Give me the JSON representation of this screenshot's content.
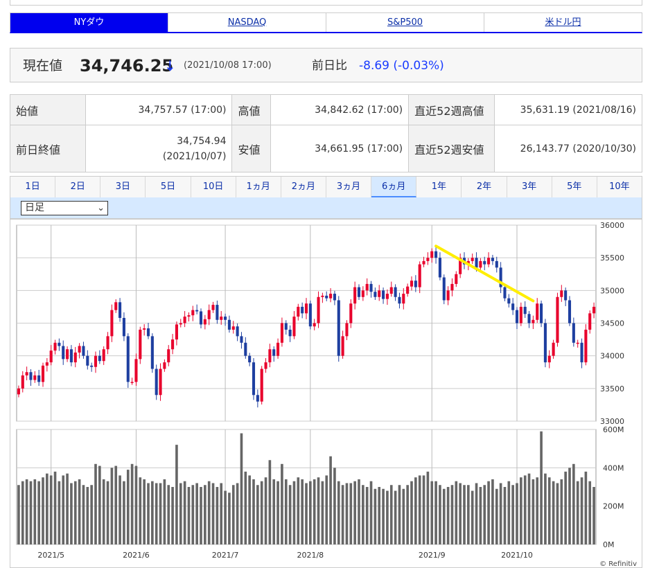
{
  "market_tabs": [
    {
      "label": "NYダウ",
      "active": true
    },
    {
      "label": "NASDAQ",
      "active": false
    },
    {
      "label": "S&P500",
      "active": false
    },
    {
      "label": "米ドル円",
      "active": false
    }
  ],
  "quote": {
    "label": "現在値",
    "value": "34,746.25",
    "direction_icon": "arrow-down-icon",
    "arrow": "↓",
    "timestamp": "(2021/10/08 17:00)",
    "change_label": "前日比",
    "change_value": "-8.69 (-0.03%)",
    "down_color": "#1a3cff"
  },
  "stats": {
    "open_label": "始値",
    "open_value": "34,757.57 (17:00)",
    "high_label": "高値",
    "high_value": "34,842.62 (17:00)",
    "wk52_high_label": "直近52週高値",
    "wk52_high_value": "35,631.19 (2021/08/16)",
    "prev_close_label": "前日終値",
    "prev_close_value": "34,754.94",
    "prev_close_date": "(2021/10/07)",
    "low_label": "安値",
    "low_value": "34,661.95 (17:00)",
    "wk52_low_label": "直近52週安値",
    "wk52_low_value": "26,143.77 (2020/10/30)"
  },
  "range_tabs": [
    {
      "label": "1日",
      "active": false
    },
    {
      "label": "2日",
      "active": false
    },
    {
      "label": "3日",
      "active": false
    },
    {
      "label": "5日",
      "active": false
    },
    {
      "label": "10日",
      "active": false
    },
    {
      "label": "1ヵ月",
      "active": false
    },
    {
      "label": "2ヵ月",
      "active": false
    },
    {
      "label": "3ヵ月",
      "active": false
    },
    {
      "label": "6ヵ月",
      "active": true
    },
    {
      "label": "1年",
      "active": false
    },
    {
      "label": "2年",
      "active": false
    },
    {
      "label": "3年",
      "active": false
    },
    {
      "label": "5年",
      "active": false
    },
    {
      "label": "10年",
      "active": false
    }
  ],
  "interval_select": {
    "value": "日足"
  },
  "chart_data": {
    "type": "candlestick",
    "x_labels": [
      "2021/5",
      "2021/6",
      "2021/7",
      "2021/8",
      "2021/9",
      "2021/10"
    ],
    "x_label_positions": [
      8,
      29,
      51,
      72,
      102,
      123
    ],
    "price_axis": {
      "ticks": [
        33000,
        33500,
        34000,
        34500,
        35000,
        35500,
        36000
      ],
      "ylim": [
        33000,
        36000
      ],
      "position": "right"
    },
    "volume_axis": {
      "ticks": [
        "0M",
        "200M",
        "400M",
        "600M"
      ],
      "tick_values": [
        0,
        200,
        400,
        600
      ],
      "ylim": [
        0,
        600
      ],
      "position": "right"
    },
    "up_color": "#e8002c",
    "down_color": "#1e3fa0",
    "trendline_color": "#ffee00",
    "trendline": [
      [
        103,
        35680
      ],
      [
        127,
        34840
      ]
    ],
    "credit": "© Refinitiv",
    "closes": [
      33500,
      33700,
      33750,
      33630,
      33700,
      33600,
      33850,
      33900,
      34080,
      34200,
      34150,
      33950,
      34100,
      33900,
      34050,
      34150,
      34000,
      33850,
      33830,
      34000,
      33920,
      34100,
      34300,
      34700,
      34820,
      34580,
      34300,
      33600,
      33600,
      33950,
      34400,
      34420,
      34300,
      33800,
      33400,
      33800,
      33900,
      34100,
      34250,
      34480,
      34500,
      34600,
      34620,
      34700,
      34680,
      34480,
      34560,
      34700,
      34780,
      34550,
      34600,
      34550,
      34400,
      34450,
      34300,
      34200,
      34000,
      33900,
      33400,
      33300,
      33800,
      33900,
      34100,
      34000,
      34200,
      34500,
      34400,
      34300,
      34600,
      34750,
      34650,
      34800,
      34450,
      34500,
      34900,
      34920,
      34880,
      34950,
      34850,
      34000,
      34300,
      34500,
      34800,
      35050,
      34900,
      35000,
      35100,
      34980,
      34900,
      35000,
      34870,
      34950,
      35050,
      34900,
      34800,
      34950,
      35060,
      35150,
      35050,
      35400,
      35450,
      35500,
      35600,
      35500,
      35200,
      34850,
      35000,
      35100,
      35250,
      35500,
      35400,
      35450,
      35500,
      35350,
      35450,
      35400,
      35500,
      35450,
      35350,
      35050,
      34880,
      34800,
      34700,
      34500,
      34750,
      34640,
      34500,
      34550,
      34800,
      34500,
      33900,
      34000,
      34200,
      34900,
      35000,
      34850,
      34500,
      34200,
      34200,
      33900,
      34400,
      34650,
      34750
    ],
    "volumes": [
      310,
      330,
      340,
      330,
      340,
      330,
      350,
      370,
      360,
      380,
      330,
      360,
      370,
      320,
      330,
      340,
      310,
      300,
      310,
      420,
      410,
      340,
      330,
      400,
      410,
      360,
      330,
      390,
      420,
      410,
      350,
      340,
      320,
      330,
      320,
      320,
      340,
      310,
      300,
      520,
      320,
      330,
      300,
      310,
      320,
      300,
      310,
      330,
      320,
      300,
      320,
      280,
      270,
      310,
      320,
      580,
      380,
      360,
      340,
      310,
      330,
      350,
      440,
      340,
      330,
      420,
      340,
      310,
      330,
      350,
      340,
      320,
      330,
      340,
      350,
      330,
      360,
      460,
      400,
      330,
      310,
      320,
      320,
      330,
      340,
      310,
      300,
      330,
      290,
      300,
      290,
      280,
      310,
      280,
      310,
      290,
      310,
      330,
      350,
      360,
      360,
      380,
      330,
      330,
      310,
      290,
      300,
      310,
      330,
      320,
      310,
      310,
      280,
      320,
      300,
      310,
      330,
      340,
      290,
      320,
      300,
      330,
      310,
      320,
      350,
      360,
      370,
      340,
      350,
      590,
      370,
      350,
      330,
      320,
      340,
      380,
      400,
      420,
      330,
      350,
      380,
      330,
      300
    ]
  }
}
